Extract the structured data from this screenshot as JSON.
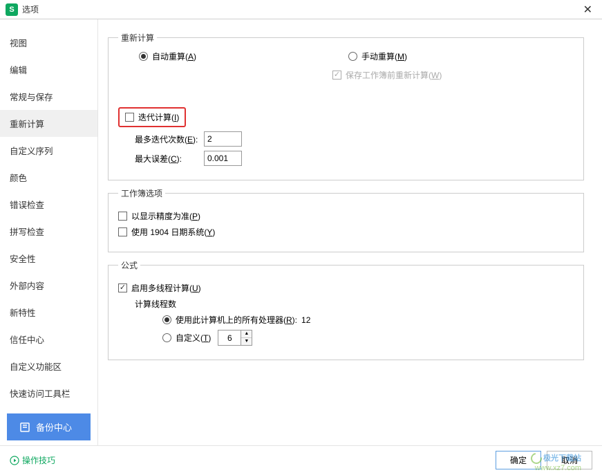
{
  "titlebar": {
    "title": "选项"
  },
  "sidebar": {
    "items": [
      {
        "label": "视图"
      },
      {
        "label": "编辑"
      },
      {
        "label": "常规与保存"
      },
      {
        "label": "重新计算"
      },
      {
        "label": "自定义序列"
      },
      {
        "label": "颜色"
      },
      {
        "label": "错误检查"
      },
      {
        "label": "拼写检查"
      },
      {
        "label": "安全性"
      },
      {
        "label": "外部内容"
      },
      {
        "label": "新特性"
      },
      {
        "label": "信任中心"
      },
      {
        "label": "自定义功能区"
      },
      {
        "label": "快速访问工具栏"
      }
    ],
    "backup": "备份中心"
  },
  "content": {
    "recalc": {
      "legend": "重新计算",
      "auto": "自动重算(",
      "autoK": "A",
      "autoE": ")",
      "manual": "手动重算(",
      "manualK": "M",
      "manualE": ")",
      "saveRecalc": "保存工作簿前重新计算(",
      "saveRecalcK": "W",
      "saveRecalcE": ")",
      "iterative": "迭代计算(",
      "iterativeK": "I",
      "iterativeE": ")",
      "maxIter": "最多迭代次数(",
      "maxIterK": "E",
      "maxIterE": "):",
      "maxIterVal": "2",
      "maxDiff": "最大误差(",
      "maxDiffK": "C",
      "maxDiffE": "):",
      "maxDiffVal": "0.001"
    },
    "workbook": {
      "legend": "工作簿选项",
      "precision": "以显示精度为准(",
      "precisionK": "P",
      "precisionE": ")",
      "date1904": "使用 1904 日期系统(",
      "date1904K": "Y",
      "date1904E": ")"
    },
    "formula": {
      "legend": "公式",
      "multithread": "启用多线程计算(",
      "multithreadK": "U",
      "multithreadE": ")",
      "threads": "计算线程数",
      "allProc": "使用此计算机上的所有处理器(",
      "allProcK": "R",
      "allProcE": "):",
      "allProcVal": "12",
      "custom": "自定义(",
      "customK": "T",
      "customE": ")",
      "customVal": "6"
    }
  },
  "footer": {
    "tips": "操作技巧",
    "ok": "确定",
    "cancel": "取消"
  },
  "watermark": {
    "line1": "极光下载站",
    "line2": "www.xz7.com"
  }
}
